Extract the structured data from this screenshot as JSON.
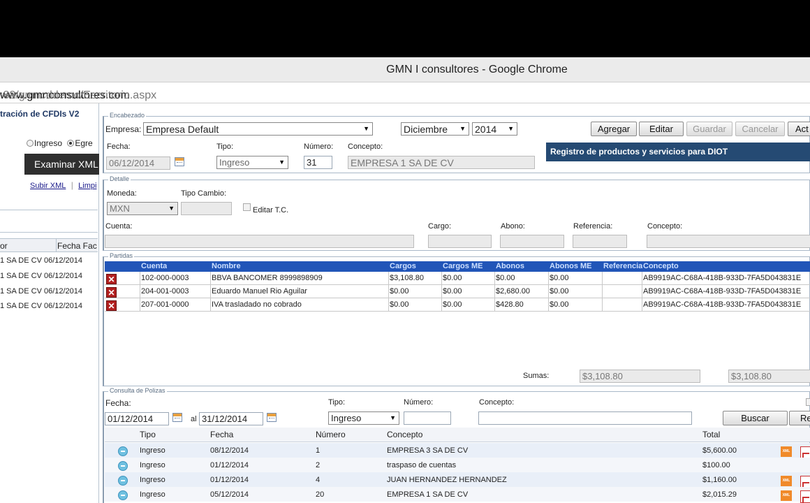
{
  "window": {
    "title": "GMN I consultores - Google Chrome"
  },
  "address": {
    "host": "www.gmnconsultores.com",
    "path": ":88/gmncddemo/Escritorio.aspx"
  },
  "left": {
    "title": "tración de CFDIs V2",
    "radio_ingreso": "Ingreso",
    "radio_egreso": "Egre",
    "examinar": "Examinar XML",
    "subir": "Subir XML",
    "limpiar": "Limpi",
    "col_rfc": "or",
    "col_fecha": "Fecha Fac",
    "rows": [
      "1 SA DE CV 06/12/2014",
      "1 SA DE CV 06/12/2014",
      "1 SA DE CV 06/12/2014",
      "1 SA DE CV 06/12/2014"
    ]
  },
  "encabezado": {
    "legend": "Encabezado",
    "empresa_label": "Empresa:",
    "empresa_value": "Empresa Default",
    "mes": "Diciembre",
    "anio": "2014",
    "buttons": {
      "agregar": "Agregar",
      "editar": "Editar",
      "guardar": "Guardar",
      "cancelar": "Cancelar",
      "act": "Act"
    },
    "fecha_label": "Fecha:",
    "fecha_value": "06/12/2014",
    "tipo_label": "Tipo:",
    "tipo_value": "Ingreso",
    "numero_label": "Número:",
    "numero_value": "31",
    "concepto_label": "Concepto:",
    "concepto_value": "EMPRESA 1 SA DE CV",
    "banner": "Registro de productos y servicios para DIOT"
  },
  "detalle": {
    "legend": "Detalle",
    "moneda_label": "Moneda:",
    "moneda_value": "MXN",
    "tipo_cambio_label": "Tipo Cambio:",
    "editar_tc": "Editar T.C.",
    "cuenta_label": "Cuenta:",
    "cargo_label": "Cargo:",
    "abono_label": "Abono:",
    "referencia_label": "Referencia:",
    "concepto_label": "Concepto:"
  },
  "partidas": {
    "legend": "Partidas",
    "columns": [
      "Cuenta",
      "Nombre",
      "Cargos",
      "Cargos ME",
      "Abonos",
      "Abonos ME",
      "Referencia",
      "Concepto"
    ],
    "rows": [
      {
        "cuenta": "102-000-0003",
        "nombre": "BBVA BANCOMER 8999898909",
        "cargos": "$3,108.80",
        "cargos_me": "$0.00",
        "abonos": "$0.00",
        "abonos_me": "$0.00",
        "referencia": "",
        "concepto": "AB9919AC-C68A-418B-933D-7FA5D043831E"
      },
      {
        "cuenta": "204-001-0003",
        "nombre": "Eduardo Manuel Rio Aguilar",
        "cargos": "$0.00",
        "cargos_me": "$0.00",
        "abonos": "$2,680.00",
        "abonos_me": "$0.00",
        "referencia": "",
        "concepto": "AB9919AC-C68A-418B-933D-7FA5D043831E"
      },
      {
        "cuenta": "207-001-0000",
        "nombre": "IVA trasladado no cobrado",
        "cargos": "$0.00",
        "cargos_me": "$0.00",
        "abonos": "$428.80",
        "abonos_me": "$0.00",
        "referencia": "",
        "concepto": "AB9919AC-C68A-418B-933D-7FA5D043831E"
      }
    ],
    "sumas_label": "Sumas:",
    "suma_cargos": "$3,108.80",
    "suma_abonos": "$3,108.80"
  },
  "consulta": {
    "legend": "Consulta de Polizas",
    "fecha_label": "Fecha:",
    "fecha_desde": "01/12/2014",
    "al_label": "al",
    "fecha_hasta": "31/12/2014",
    "tipo_label": "Tipo:",
    "tipo_value": "Ingreso",
    "numero_label": "Número:",
    "concepto_label": "Concepto:",
    "buscar": "Buscar",
    "re": "Re",
    "columns": [
      "Tipo",
      "Fecha",
      "Número",
      "Concepto",
      "Total"
    ],
    "rows": [
      {
        "tipo": "Ingreso",
        "fecha": "08/12/2014",
        "numero": "1",
        "concepto": "EMPRESA 3 SA DE CV",
        "total": "$5,600.00",
        "xml": true
      },
      {
        "tipo": "Ingreso",
        "fecha": "01/12/2014",
        "numero": "2",
        "concepto": "traspaso de cuentas",
        "total": "$100.00",
        "xml": false
      },
      {
        "tipo": "Ingreso",
        "fecha": "01/12/2014",
        "numero": "4",
        "concepto": "JUAN HERNANDEZ HERNANDEZ",
        "total": "$1,160.00",
        "xml": true
      },
      {
        "tipo": "Ingreso",
        "fecha": "05/12/2014",
        "numero": "20",
        "concepto": "EMPRESA 1 SA DE CV",
        "total": "$2,015.29",
        "xml": true
      }
    ]
  },
  "icons": {
    "row_action": "circle-minus-icon",
    "delete": "delete-x-icon",
    "calendar": "calendar-icon",
    "xml": "xml-file-icon",
    "pdf": "pdf-file-icon"
  },
  "colors": {
    "grid_header": "#2155b8",
    "banner": "#254a73",
    "delete": "#b22020"
  }
}
